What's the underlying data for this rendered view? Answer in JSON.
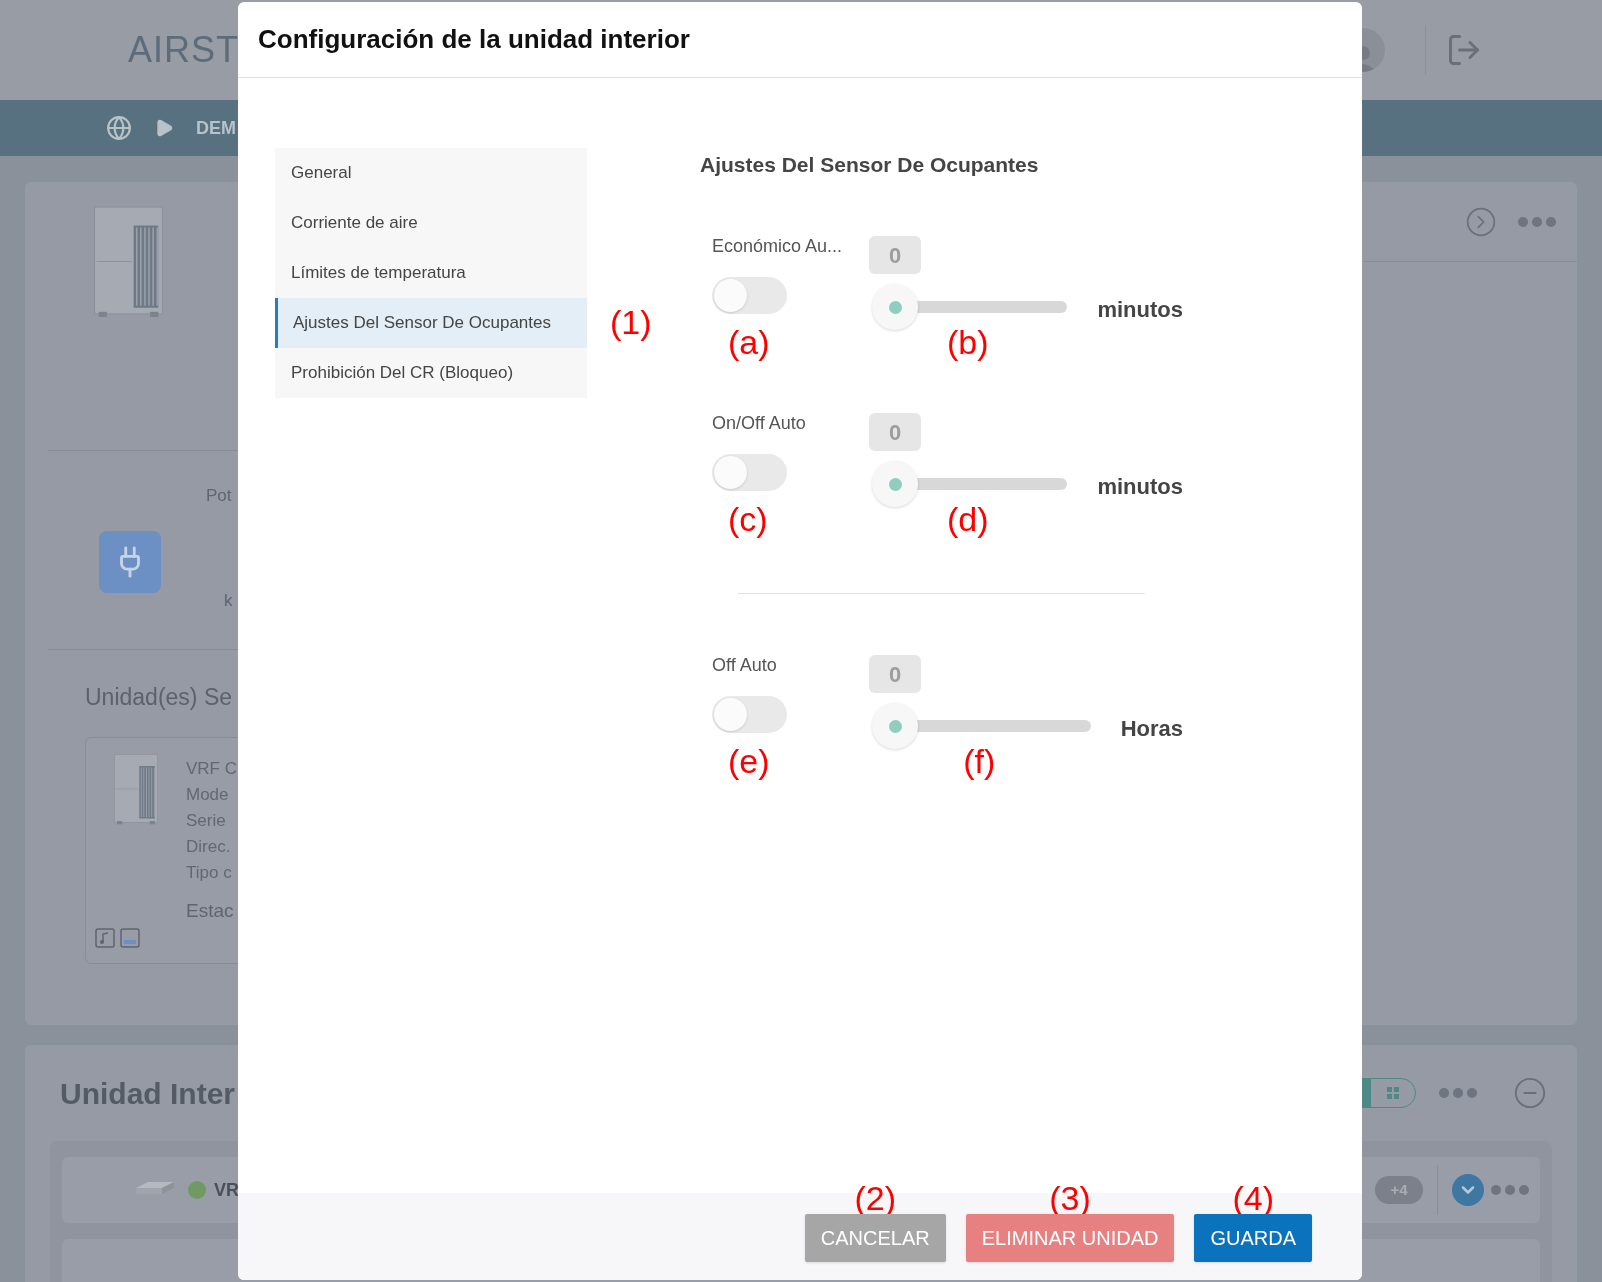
{
  "background": {
    "logo": "AIRST",
    "breadcrumb": "DEM",
    "power_label": "Pot",
    "power_unit": "k",
    "served_title": "Unidad(es) Se",
    "unit_lines": [
      "VRF C",
      "Mode",
      "Serie",
      "Direc.",
      "Tipo c"
    ],
    "unit_status": "Estac",
    "indoor_title": "Unidad Inter",
    "row_name": "VR",
    "row_badge": "+4"
  },
  "modal": {
    "title": "Configuración de la unidad interior",
    "menu": [
      {
        "label": "General",
        "selected": false
      },
      {
        "label": "Corriente de aire",
        "selected": false
      },
      {
        "label": "Límites de temperatura",
        "selected": false
      },
      {
        "label": "Ajustes Del Sensor De Ocupantes",
        "selected": true
      },
      {
        "label": "Prohibición Del CR (Bloqueo)",
        "selected": false
      }
    ],
    "menu_marker": "(1)",
    "section_title": "Ajustes Del Sensor De Ocupantes",
    "settings": [
      {
        "label": "Económico Au...",
        "on": false,
        "value": "0",
        "unit": "minutos",
        "toggle_marker": "(a)",
        "slider_marker": "(b)"
      },
      {
        "label": "On/Off Auto",
        "on": false,
        "value": "0",
        "unit": "minutos",
        "toggle_marker": "(c)",
        "slider_marker": "(d)"
      },
      {
        "label": "Off Auto",
        "on": false,
        "value": "0",
        "unit": "Horas",
        "toggle_marker": "(e)",
        "slider_marker": "(f)"
      }
    ],
    "buttons": [
      {
        "label": "CANCELAR",
        "kind": "cancel",
        "marker": "(2)"
      },
      {
        "label": "ELIMINAR UNIDAD",
        "kind": "delete",
        "marker": "(3)"
      },
      {
        "label": "GUARDA",
        "kind": "save",
        "marker": "(4)"
      }
    ]
  }
}
